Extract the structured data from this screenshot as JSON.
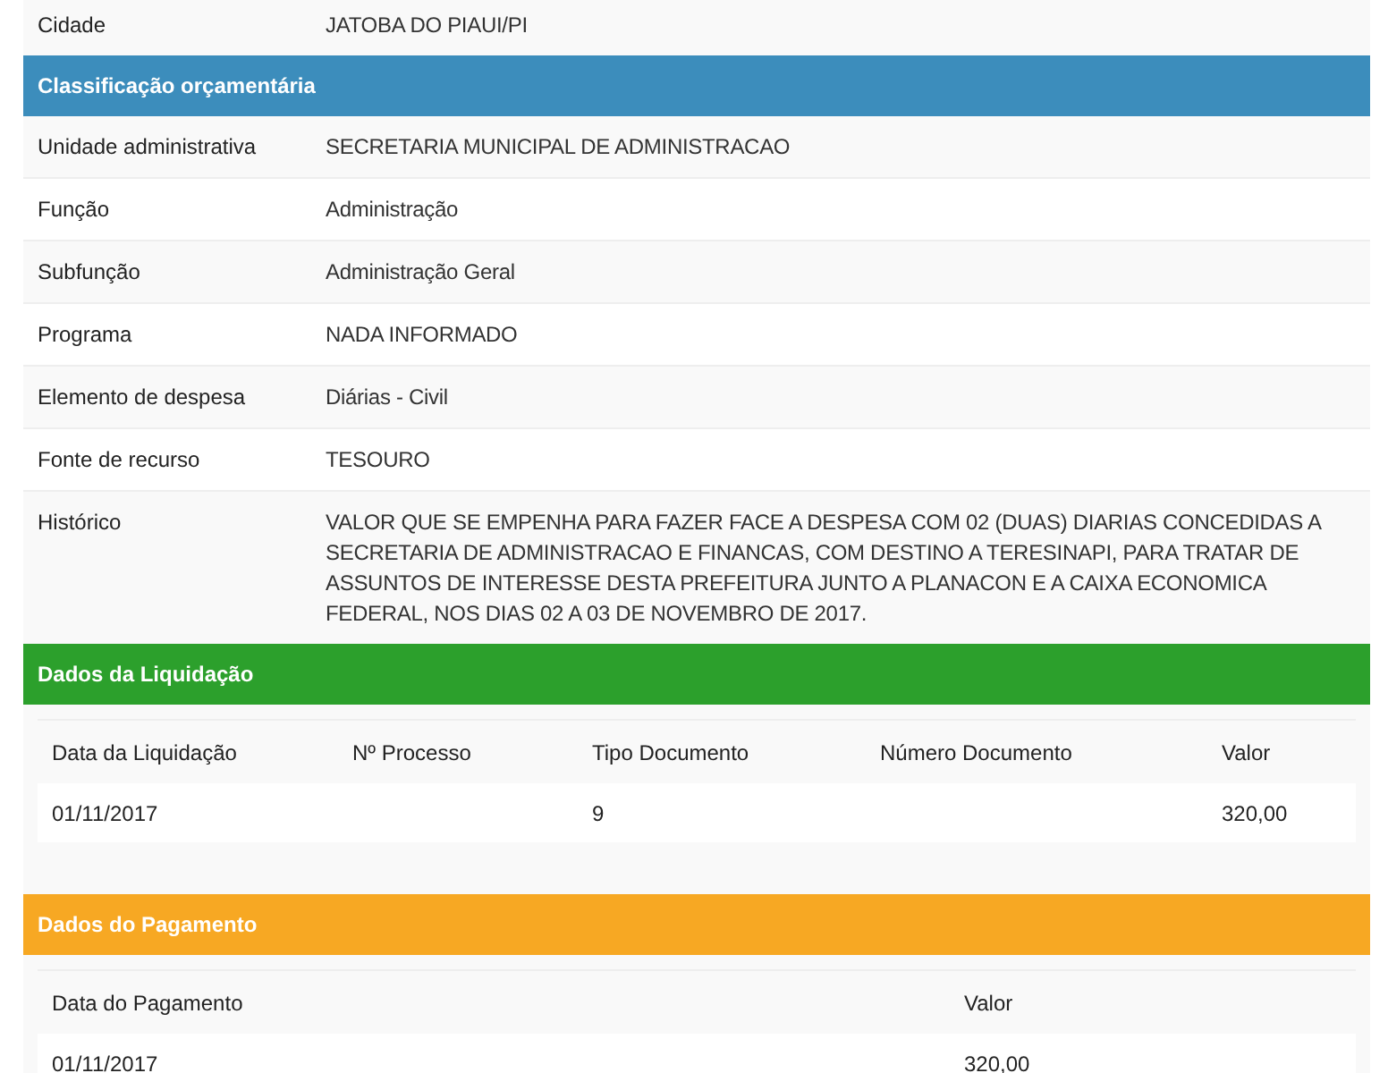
{
  "top_rows": [
    {
      "label": "Cidade",
      "value": "JATOBA DO PIAUI/PI"
    }
  ],
  "sections": [
    {
      "kind": "fields",
      "title": "Classificação orçamentária",
      "color": "#3c8dbc",
      "rows": [
        {
          "label": "Unidade administrativa",
          "value": "SECRETARIA MUNICIPAL DE ADMINISTRACAO"
        },
        {
          "label": "Função",
          "value": "Administração"
        },
        {
          "label": "Subfunção",
          "value": "Administração Geral"
        },
        {
          "label": "Programa",
          "value": "NADA INFORMADO"
        },
        {
          "label": "Elemento de despesa",
          "value": "Diárias - Civil"
        },
        {
          "label": "Fonte de recurso",
          "value": "TESOURO"
        },
        {
          "label": "Histórico",
          "value": "VALOR QUE SE EMPENHA PARA FAZER FACE A DESPESA COM 02 (DUAS) DIARIAS CONCEDIDAS A SECRETARIA DE ADMINISTRACAO E FINANCAS, COM DESTINO A TERESINAPI, PARA TRATAR DE ASSUNTOS DE INTERESSE DESTA PREFEITURA JUNTO A PLANACON E A CAIXA ECONOMICA FEDERAL, NOS DIAS 02 A 03 DE NOVEMBRO DE 2017."
        }
      ]
    },
    {
      "kind": "table",
      "title": "Dados da Liquidação",
      "color": "#2ca02c",
      "columns": [
        "Data da Liquidação",
        "Nº Processo",
        "Tipo Documento",
        "Número Documento",
        "Valor"
      ],
      "rows": [
        [
          "01/11/2017",
          null,
          "9",
          null,
          "320,00"
        ]
      ]
    },
    {
      "kind": "table",
      "title": "Dados do Pagamento",
      "color": "#f7a823",
      "columns": [
        "Data do Pagamento",
        "Valor"
      ],
      "rows": [
        [
          "01/11/2017",
          "320,00"
        ]
      ]
    }
  ]
}
